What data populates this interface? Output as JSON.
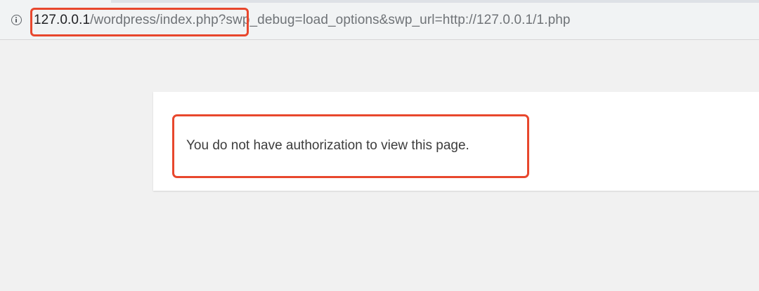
{
  "browser": {
    "address_bar": {
      "info_icon": "info-icon",
      "url_host": "127.0.0.1",
      "url_rest": "/wordpress/index.php?swp_debug=load_options&swp_url=http://127.0.0.1/1.php"
    }
  },
  "page": {
    "message": "You do not have authorization to view this page."
  },
  "colors": {
    "highlight": "#e8472d",
    "page_background": "#f1f1f1",
    "card_background": "#ffffff"
  }
}
